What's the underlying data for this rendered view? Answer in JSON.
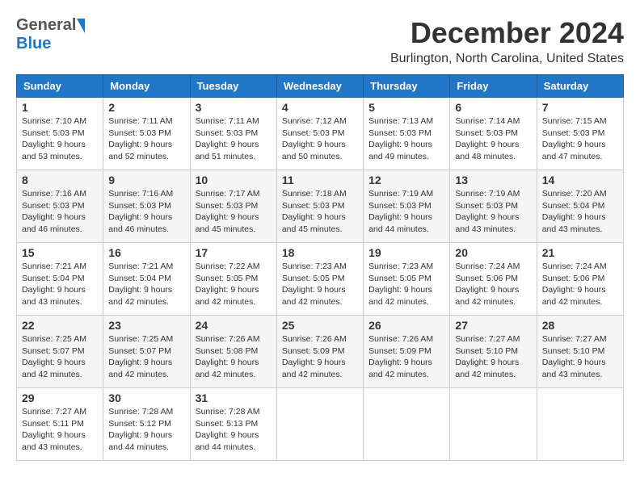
{
  "logo": {
    "general": "General",
    "blue": "Blue"
  },
  "title": "December 2024",
  "location": "Burlington, North Carolina, United States",
  "days_header": [
    "Sunday",
    "Monday",
    "Tuesday",
    "Wednesday",
    "Thursday",
    "Friday",
    "Saturday"
  ],
  "weeks": [
    [
      {
        "day": "1",
        "sunrise": "Sunrise: 7:10 AM",
        "sunset": "Sunset: 5:03 PM",
        "daylight": "Daylight: 9 hours and 53 minutes."
      },
      {
        "day": "2",
        "sunrise": "Sunrise: 7:11 AM",
        "sunset": "Sunset: 5:03 PM",
        "daylight": "Daylight: 9 hours and 52 minutes."
      },
      {
        "day": "3",
        "sunrise": "Sunrise: 7:11 AM",
        "sunset": "Sunset: 5:03 PM",
        "daylight": "Daylight: 9 hours and 51 minutes."
      },
      {
        "day": "4",
        "sunrise": "Sunrise: 7:12 AM",
        "sunset": "Sunset: 5:03 PM",
        "daylight": "Daylight: 9 hours and 50 minutes."
      },
      {
        "day": "5",
        "sunrise": "Sunrise: 7:13 AM",
        "sunset": "Sunset: 5:03 PM",
        "daylight": "Daylight: 9 hours and 49 minutes."
      },
      {
        "day": "6",
        "sunrise": "Sunrise: 7:14 AM",
        "sunset": "Sunset: 5:03 PM",
        "daylight": "Daylight: 9 hours and 48 minutes."
      },
      {
        "day": "7",
        "sunrise": "Sunrise: 7:15 AM",
        "sunset": "Sunset: 5:03 PM",
        "daylight": "Daylight: 9 hours and 47 minutes."
      }
    ],
    [
      {
        "day": "8",
        "sunrise": "Sunrise: 7:16 AM",
        "sunset": "Sunset: 5:03 PM",
        "daylight": "Daylight: 9 hours and 46 minutes."
      },
      {
        "day": "9",
        "sunrise": "Sunrise: 7:16 AM",
        "sunset": "Sunset: 5:03 PM",
        "daylight": "Daylight: 9 hours and 46 minutes."
      },
      {
        "day": "10",
        "sunrise": "Sunrise: 7:17 AM",
        "sunset": "Sunset: 5:03 PM",
        "daylight": "Daylight: 9 hours and 45 minutes."
      },
      {
        "day": "11",
        "sunrise": "Sunrise: 7:18 AM",
        "sunset": "Sunset: 5:03 PM",
        "daylight": "Daylight: 9 hours and 45 minutes."
      },
      {
        "day": "12",
        "sunrise": "Sunrise: 7:19 AM",
        "sunset": "Sunset: 5:03 PM",
        "daylight": "Daylight: 9 hours and 44 minutes."
      },
      {
        "day": "13",
        "sunrise": "Sunrise: 7:19 AM",
        "sunset": "Sunset: 5:03 PM",
        "daylight": "Daylight: 9 hours and 43 minutes."
      },
      {
        "day": "14",
        "sunrise": "Sunrise: 7:20 AM",
        "sunset": "Sunset: 5:04 PM",
        "daylight": "Daylight: 9 hours and 43 minutes."
      }
    ],
    [
      {
        "day": "15",
        "sunrise": "Sunrise: 7:21 AM",
        "sunset": "Sunset: 5:04 PM",
        "daylight": "Daylight: 9 hours and 43 minutes."
      },
      {
        "day": "16",
        "sunrise": "Sunrise: 7:21 AM",
        "sunset": "Sunset: 5:04 PM",
        "daylight": "Daylight: 9 hours and 42 minutes."
      },
      {
        "day": "17",
        "sunrise": "Sunrise: 7:22 AM",
        "sunset": "Sunset: 5:05 PM",
        "daylight": "Daylight: 9 hours and 42 minutes."
      },
      {
        "day": "18",
        "sunrise": "Sunrise: 7:23 AM",
        "sunset": "Sunset: 5:05 PM",
        "daylight": "Daylight: 9 hours and 42 minutes."
      },
      {
        "day": "19",
        "sunrise": "Sunrise: 7:23 AM",
        "sunset": "Sunset: 5:05 PM",
        "daylight": "Daylight: 9 hours and 42 minutes."
      },
      {
        "day": "20",
        "sunrise": "Sunrise: 7:24 AM",
        "sunset": "Sunset: 5:06 PM",
        "daylight": "Daylight: 9 hours and 42 minutes."
      },
      {
        "day": "21",
        "sunrise": "Sunrise: 7:24 AM",
        "sunset": "Sunset: 5:06 PM",
        "daylight": "Daylight: 9 hours and 42 minutes."
      }
    ],
    [
      {
        "day": "22",
        "sunrise": "Sunrise: 7:25 AM",
        "sunset": "Sunset: 5:07 PM",
        "daylight": "Daylight: 9 hours and 42 minutes."
      },
      {
        "day": "23",
        "sunrise": "Sunrise: 7:25 AM",
        "sunset": "Sunset: 5:07 PM",
        "daylight": "Daylight: 9 hours and 42 minutes."
      },
      {
        "day": "24",
        "sunrise": "Sunrise: 7:26 AM",
        "sunset": "Sunset: 5:08 PM",
        "daylight": "Daylight: 9 hours and 42 minutes."
      },
      {
        "day": "25",
        "sunrise": "Sunrise: 7:26 AM",
        "sunset": "Sunset: 5:09 PM",
        "daylight": "Daylight: 9 hours and 42 minutes."
      },
      {
        "day": "26",
        "sunrise": "Sunrise: 7:26 AM",
        "sunset": "Sunset: 5:09 PM",
        "daylight": "Daylight: 9 hours and 42 minutes."
      },
      {
        "day": "27",
        "sunrise": "Sunrise: 7:27 AM",
        "sunset": "Sunset: 5:10 PM",
        "daylight": "Daylight: 9 hours and 42 minutes."
      },
      {
        "day": "28",
        "sunrise": "Sunrise: 7:27 AM",
        "sunset": "Sunset: 5:10 PM",
        "daylight": "Daylight: 9 hours and 43 minutes."
      }
    ],
    [
      {
        "day": "29",
        "sunrise": "Sunrise: 7:27 AM",
        "sunset": "Sunset: 5:11 PM",
        "daylight": "Daylight: 9 hours and 43 minutes."
      },
      {
        "day": "30",
        "sunrise": "Sunrise: 7:28 AM",
        "sunset": "Sunset: 5:12 PM",
        "daylight": "Daylight: 9 hours and 44 minutes."
      },
      {
        "day": "31",
        "sunrise": "Sunrise: 7:28 AM",
        "sunset": "Sunset: 5:13 PM",
        "daylight": "Daylight: 9 hours and 44 minutes."
      },
      null,
      null,
      null,
      null
    ]
  ]
}
